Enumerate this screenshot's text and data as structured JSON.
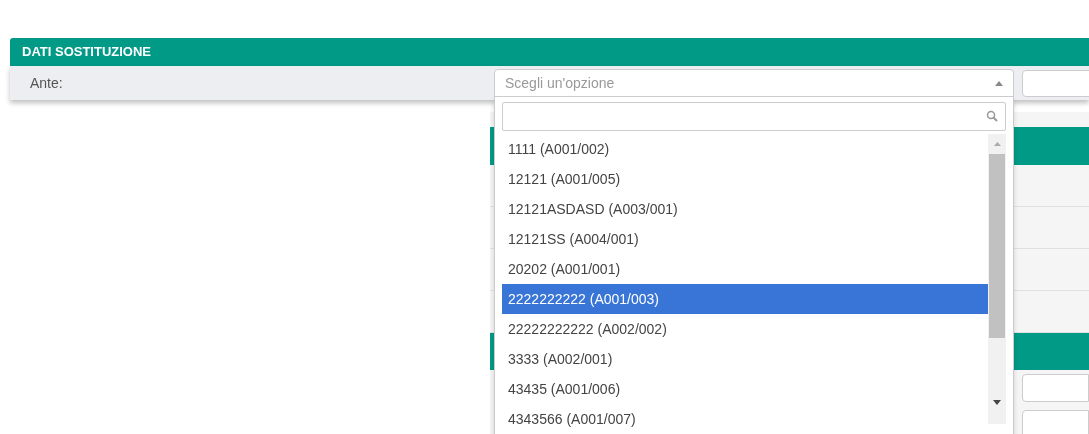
{
  "section": {
    "title": "DATI SOSTITUZIONE"
  },
  "field": {
    "label": "Ante:",
    "select": {
      "placeholder": "Scegli un'opzione",
      "expanded": true
    }
  },
  "options": [
    {
      "label": "1111 (A001/002)",
      "selected": false
    },
    {
      "label": "12121 (A001/005)",
      "selected": false
    },
    {
      "label": "12121ASDASD (A003/001)",
      "selected": false
    },
    {
      "label": "12121SS (A004/001)",
      "selected": false
    },
    {
      "label": "20202 (A001/001)",
      "selected": false
    },
    {
      "label": "2222222222 (A001/003)",
      "selected": true
    },
    {
      "label": "22222222222 (A002/002)",
      "selected": false
    },
    {
      "label": "3333 (A002/001)",
      "selected": false
    },
    {
      "label": "43435 (A001/006)",
      "selected": false
    },
    {
      "label": "4343566 (A001/007)",
      "selected": false
    }
  ]
}
